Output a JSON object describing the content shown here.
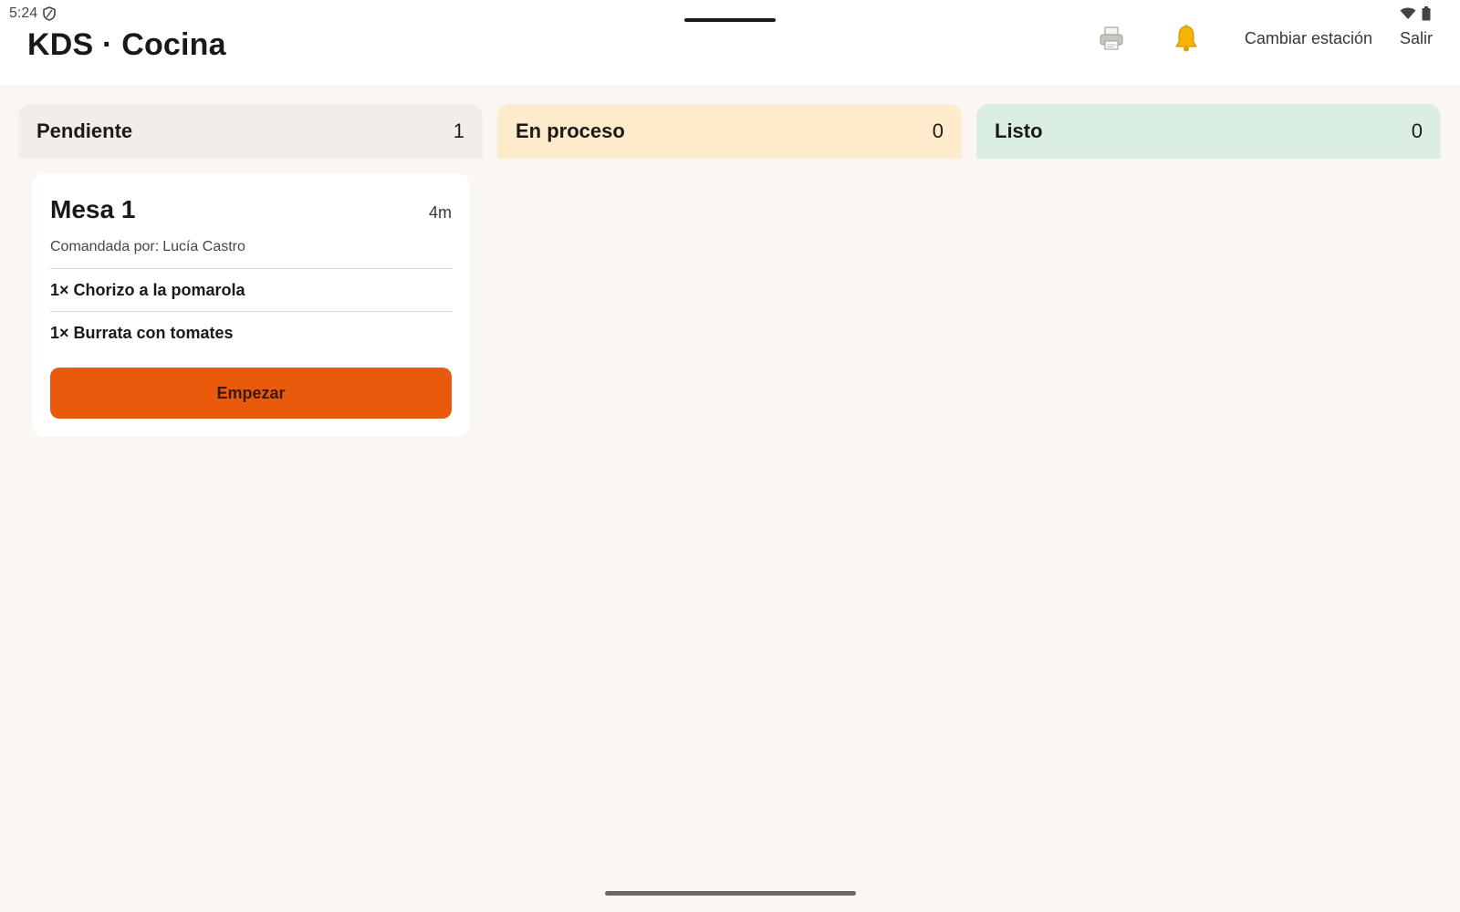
{
  "status_bar": {
    "time": "5:24"
  },
  "app_bar": {
    "title": "KDS · Cocina",
    "change_station_label": "Cambiar estación",
    "logout_label": "Salir"
  },
  "columns": [
    {
      "label": "Pendiente",
      "count": "1",
      "color": "#f2ede8"
    },
    {
      "label": "En proceso",
      "count": "0",
      "color": "#fdebcc"
    },
    {
      "label": "Listo",
      "count": "0",
      "color": "#dbeee2"
    }
  ],
  "orders": [
    {
      "table": "Mesa 1",
      "elapsed": "4m",
      "ordered_by_label": "Comandada por:",
      "ordered_by": "Lucía Castro",
      "items": [
        "1× Chorizo a la pomarola",
        "1× Burrata con tomates"
      ],
      "action_label": "Empezar"
    }
  ],
  "accent_color": "#e95a0c",
  "icons": [
    "shield-icon",
    "wifi-icon",
    "battery-icon",
    "printer-icon",
    "bell-icon"
  ]
}
